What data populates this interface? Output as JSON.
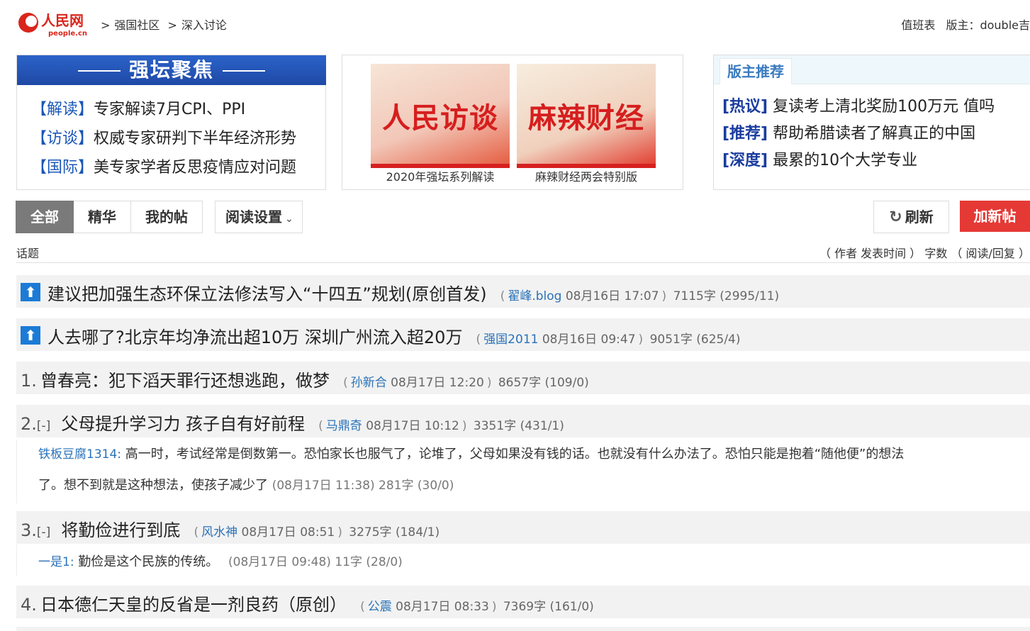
{
  "header": {
    "logo_text": "人民网",
    "logo_sub": "people.cn",
    "breadcrumbs": [
      "强国社区",
      "深入讨论"
    ],
    "crumb_sep": ">",
    "schedule": "值班表",
    "moderator": "版主：double吉"
  },
  "focus": {
    "banner": "强坛聚焦",
    "items": [
      {
        "tag": "【解读】",
        "text": "专家解读7月CPI、PPI"
      },
      {
        "tag": "【访谈】",
        "text": "权威专家研判下半年经济形势"
      },
      {
        "tag": "【国际】",
        "text": "美专家学者反思疫情应对问题"
      }
    ]
  },
  "promos": [
    {
      "image_text": "人民访谈",
      "caption": "2020年强坛系列解读"
    },
    {
      "image_text": "麻辣财经",
      "caption": "麻辣财经两会特别版"
    }
  ],
  "recommend": {
    "title": "版主推荐",
    "items": [
      {
        "tag": "[热议]",
        "text": "复读考上清北奖励100万元 值吗"
      },
      {
        "tag": "[推荐]",
        "text": "帮助希腊读者了解真正的中国"
      },
      {
        "tag": "[深度]",
        "text": "最累的10个大学专业"
      }
    ]
  },
  "tabs": [
    "全部",
    "精华",
    "我的帖"
  ],
  "read_settings": "阅读设置",
  "refresh": "刷新",
  "new_post": "加新帖",
  "list_head": {
    "left": "话题",
    "right": "（ 作者 发表时间 ） 字数 （ 阅读/回复 ）"
  },
  "threads": [
    {
      "num": "",
      "pinned": true,
      "title": "建议把加强生态环保立法修法写入“十四五”规划(原创首发)",
      "author": "翟峰.blog",
      "time": "08月16日 17:07",
      "chars": "7115字",
      "stats": "(2995/11)"
    },
    {
      "num": "",
      "pinned": true,
      "title": "人去哪了?北京年均净流出超10万 深圳广州流入超20万",
      "author": "强国2011",
      "time": "08月16日 09:47",
      "chars": "9051字",
      "stats": "(625/4)"
    },
    {
      "num": "1.",
      "pinned": false,
      "title": "曾春亮：犯下滔天罪行还想逃跑，做梦",
      "author": "孙新合",
      "time": "08月17日 12:20",
      "chars": "8657字",
      "stats": "(109/0)"
    },
    {
      "num": "2.",
      "pinned": false,
      "toggle": "[-]",
      "title": "父母提升学习力 孩子自有好前程",
      "author": "马鼎奇",
      "time": "08月17日 10:12",
      "chars": "3351字",
      "stats": "(431/1)"
    },
    {
      "num": "3.",
      "pinned": false,
      "toggle": "[-]",
      "title": "将勤俭进行到底",
      "author": "风水神",
      "time": "08月17日 08:51",
      "chars": "3275字",
      "stats": "(184/1)"
    },
    {
      "num": "4.",
      "pinned": false,
      "title": "日本德仁天皇的反省是一剂良药（原创）",
      "author": "公震",
      "time": "08月17日 08:33",
      "chars": "7369字",
      "stats": "(161/0)"
    }
  ],
  "replies": [
    {
      "author": "铁板豆腐1314:",
      "text_line1": "高一时，考试经常是倒数第一。恐怕家长也服气了，论堆了，父母如果没有钱的话。也就没有什么办法了。恐怕只能是抱着“随他便”的想法",
      "text_line2": "了。想不到就是这种想法，使孩子减少了",
      "meta": "(08月17日 11:38) 281字 (30/0)"
    },
    {
      "author": "一是1:",
      "text": "勤俭是这个民族的传统。",
      "meta": "(08月17日 09:48) 11字 (28/0)"
    }
  ],
  "colors": {
    "accent": "#1a56b8",
    "new_post": "#e53935",
    "active_tab": "#7a7a7a",
    "pin": "#1c7bd6"
  }
}
